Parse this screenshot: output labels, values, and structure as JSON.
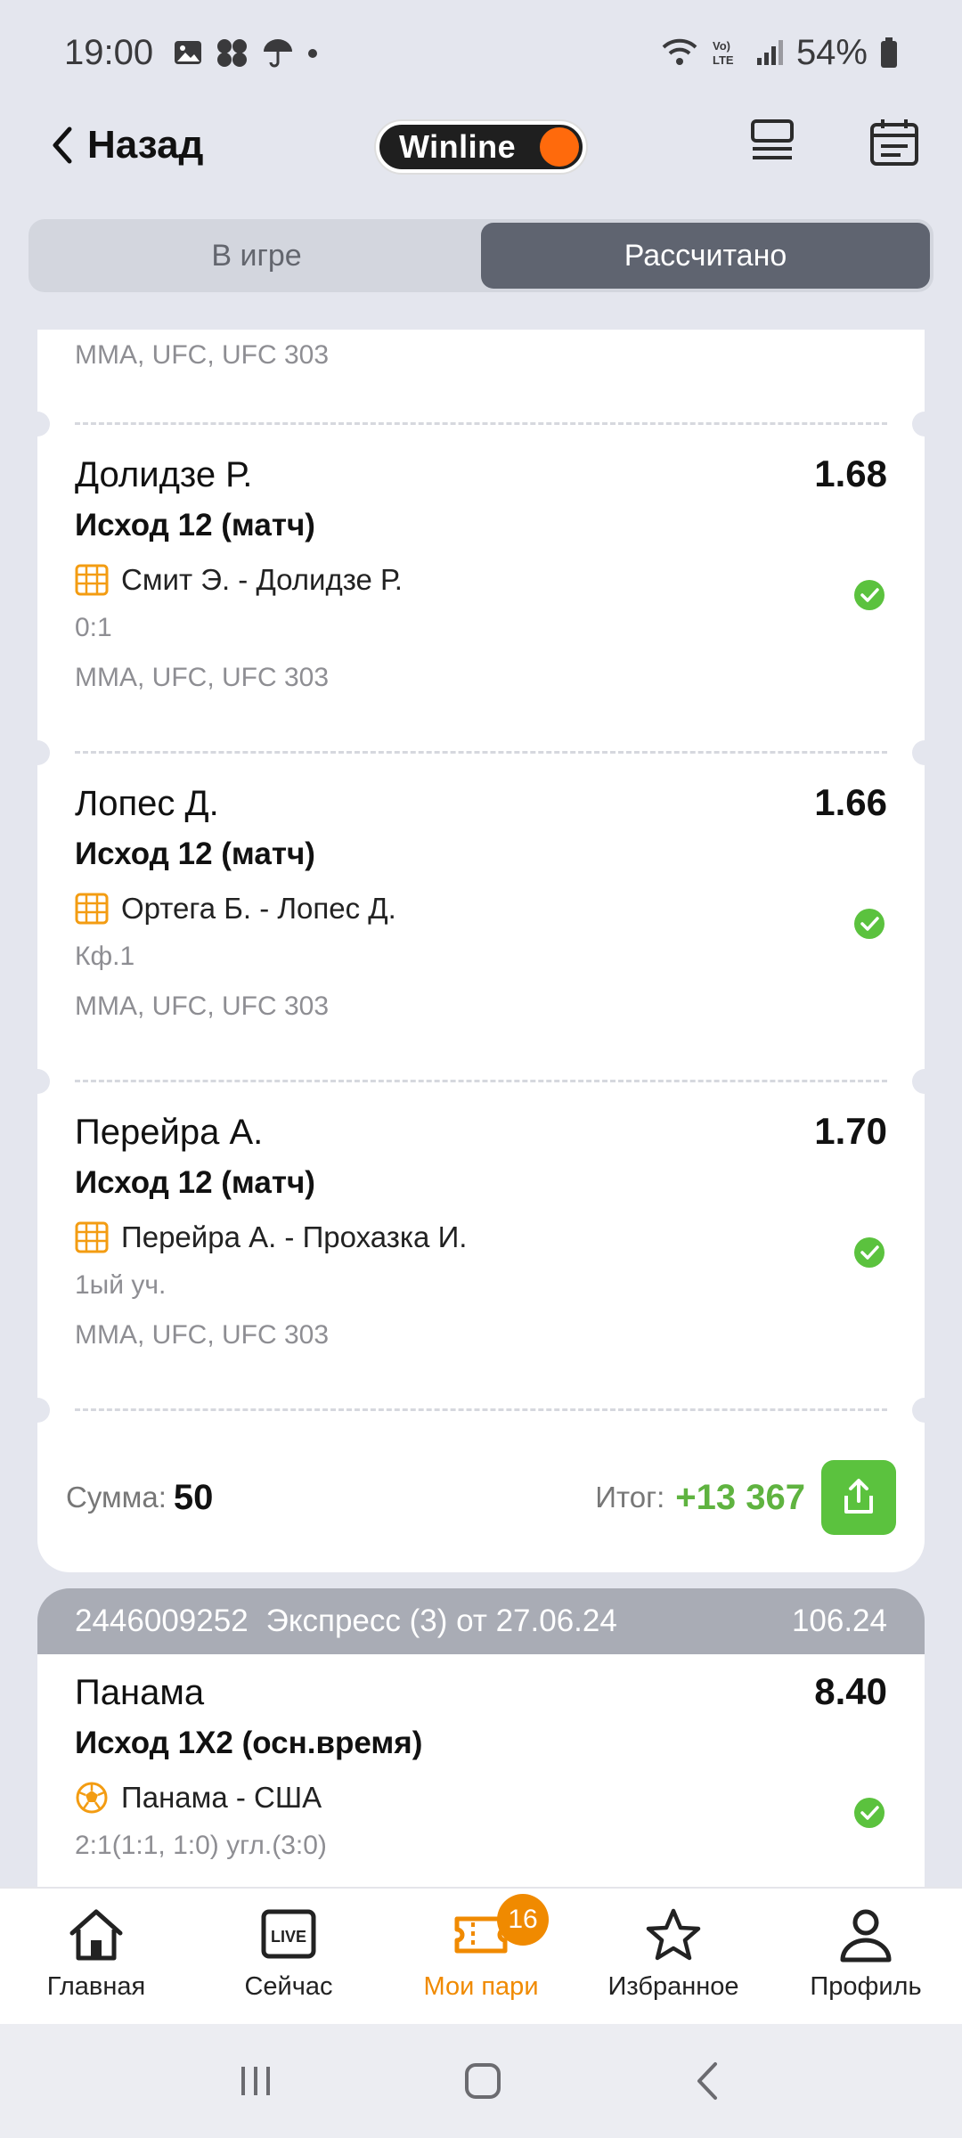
{
  "status_bar": {
    "time": "19:00",
    "battery": "54%"
  },
  "header": {
    "back_label": "Назад",
    "logo_text": "Winline"
  },
  "segments": [
    {
      "label": "В игре",
      "active": false
    },
    {
      "label": "Рассчитано",
      "active": true
    }
  ],
  "coupon1": {
    "top_meta": "MMA, UFC, UFC 303",
    "bets": [
      {
        "name": "Долидзе Р.",
        "odds": "1.68",
        "outcome": "Исход 12 (матч)",
        "match": "Смит Э. - Долидзе Р.",
        "score": "0:1",
        "league": "MMA, UFC, UFC 303"
      },
      {
        "name": "Лопес Д.",
        "odds": "1.66",
        "outcome": "Исход 12 (матч)",
        "match": "Ортега Б. - Лопес Д.",
        "score": "Кф.1",
        "league": "MMA, UFC, UFC 303"
      },
      {
        "name": "Перейра А.",
        "odds": "1.70",
        "outcome": "Исход 12 (матч)",
        "match": "Перейра А. - Прохазка И.",
        "score": "1ый уч.",
        "league": "MMA, UFC, UFC 303"
      }
    ],
    "sum_label": "Сумма:",
    "sum_value": "50",
    "total_label": "Итог:",
    "total_value": "+13 367"
  },
  "coupon2": {
    "id": "2446009252",
    "desc": "Экспресс (3)  от 27.06.24",
    "amount": "106.24",
    "bet": {
      "name": "Панама",
      "odds": "8.40",
      "outcome": "Исход 1X2 (осн.время)",
      "match": "Панама - США",
      "score": "2:1(1:1, 1:0) угл.(3:0)"
    }
  },
  "tabbar": {
    "items": [
      {
        "label": "Главная",
        "icon": "home-icon"
      },
      {
        "label": "Сейчас",
        "icon": "live-icon"
      },
      {
        "label": "Мои пари",
        "icon": "ticket-icon",
        "badge": "16",
        "active": true
      },
      {
        "label": "Избранное",
        "icon": "star-icon"
      },
      {
        "label": "Профиль",
        "icon": "profile-icon"
      }
    ]
  },
  "colors": {
    "accent": "#f08a00",
    "win_green": "#5fb340",
    "logo_dot": "#ff6a0c"
  }
}
